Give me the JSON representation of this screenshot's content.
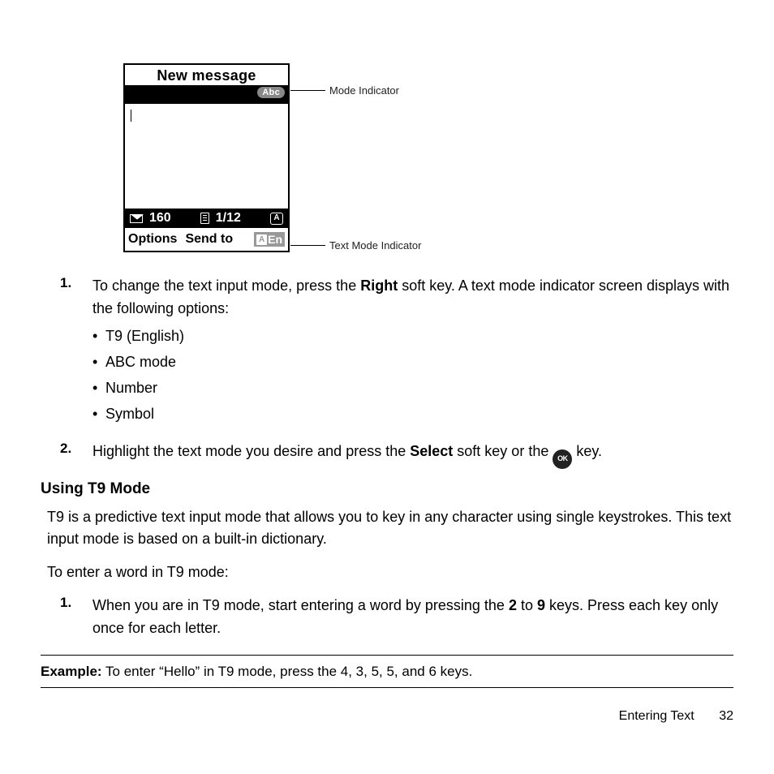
{
  "phone": {
    "title": "New message",
    "mode_abc": "Abc",
    "status": {
      "chars": "160",
      "page": "1/12",
      "a_label": "A"
    },
    "softkeys": {
      "left": "Options",
      "center": "Send to",
      "text_mode_a": "A",
      "text_mode_lang": "En"
    }
  },
  "callouts": {
    "mode": "Mode Indicator",
    "textmode": "Text Mode Indicator"
  },
  "steps_a": [
    {
      "num": "1.",
      "before": "To change the text input mode, press the ",
      "bold1": "Right",
      "after1": " soft key. A text mode indicator screen displays with the following options:",
      "bullets": [
        "T9 (English)",
        "ABC mode",
        "Number",
        "Symbol"
      ]
    },
    {
      "num": "2.",
      "before": "Highlight the text mode you desire and press the ",
      "bold1": "Select",
      "after1": " soft key or the ",
      "ok": "OK",
      "after2": " key."
    }
  ],
  "section": {
    "title": "Using T9 Mode",
    "p1": "T9 is a predictive text input mode that allows you to key in any character using single keystrokes. This text input mode is based on a built-in dictionary.",
    "p2": "To enter a word in T9 mode:"
  },
  "steps_b": [
    {
      "num": "1.",
      "before": "When you are in T9 mode, start entering a word by pressing the ",
      "bold1": "2",
      "mid": " to ",
      "bold2": "9",
      "after": " keys. Press each key only once for each letter."
    }
  ],
  "example": {
    "label": "Example:",
    "text": " To enter “Hello” in T9 mode, press the 4, 3, 5, 5, and 6 keys."
  },
  "footer": {
    "section": "Entering Text",
    "page": "32"
  }
}
